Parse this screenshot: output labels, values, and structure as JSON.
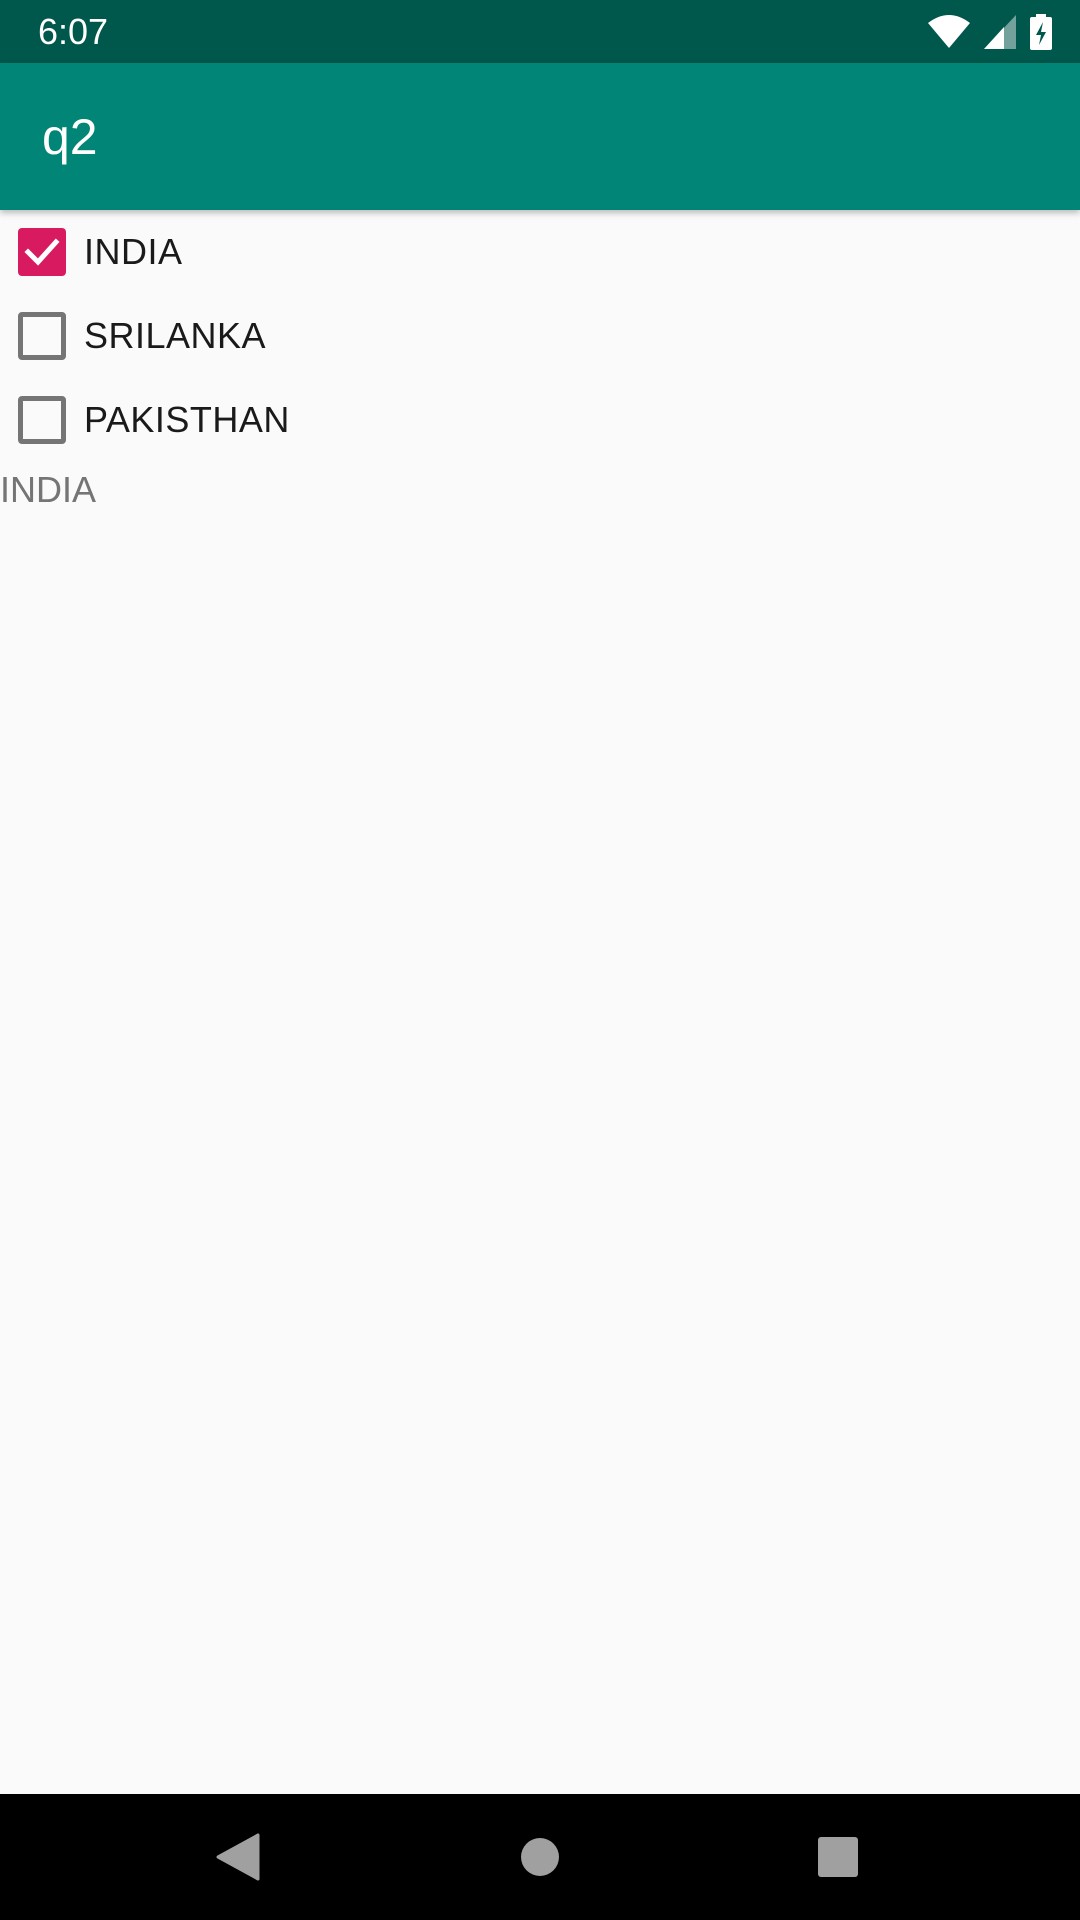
{
  "status_bar": {
    "time": "6:07",
    "icons": [
      "wifi-icon",
      "cell-signal-icon",
      "battery-charging-icon"
    ]
  },
  "app_bar": {
    "title": "q2",
    "color": "#008577"
  },
  "checkboxes": [
    {
      "label": "INDIA",
      "checked": true
    },
    {
      "label": "SRILANKA",
      "checked": false
    },
    {
      "label": "PAKISTHAN",
      "checked": false
    }
  ],
  "result": {
    "text": "INDIA"
  },
  "colors": {
    "status_bar": "#00574b",
    "app_bar": "#008577",
    "accent": "#d81b60",
    "background": "#fafafa"
  },
  "nav_bar": {
    "buttons": [
      "back-icon",
      "home-icon",
      "recents-icon"
    ]
  }
}
